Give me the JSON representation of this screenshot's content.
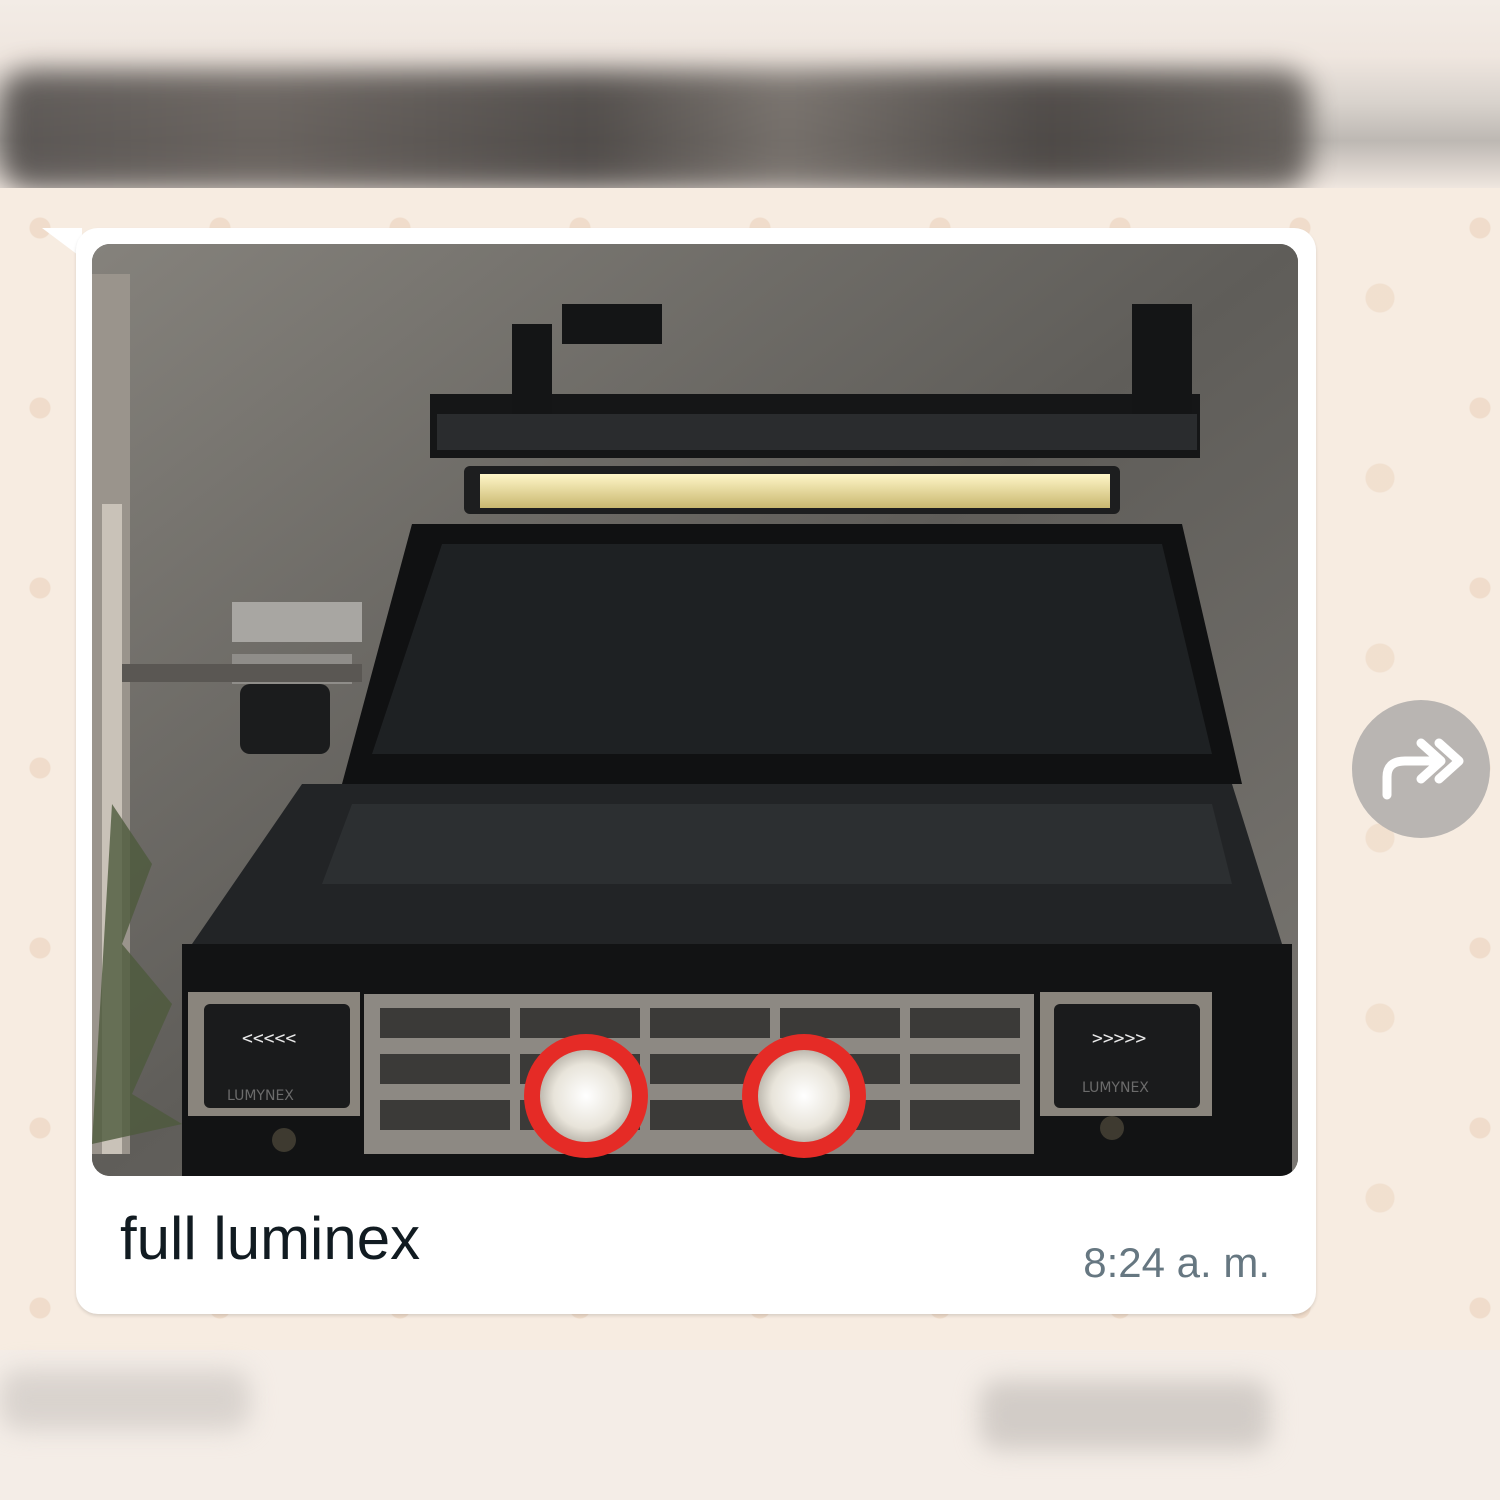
{
  "message": {
    "caption": "full luminex",
    "time": "8:24 a. m.",
    "image_brand_text": "LUMYNEX"
  },
  "actions": {
    "forward_icon": "forward-icon"
  },
  "colors": {
    "bubble": "#ffffff",
    "wallpaper": "#f7ece1",
    "caption_text": "#111b21",
    "time_text": "#667781",
    "forward_button": "#b9b5b2"
  }
}
